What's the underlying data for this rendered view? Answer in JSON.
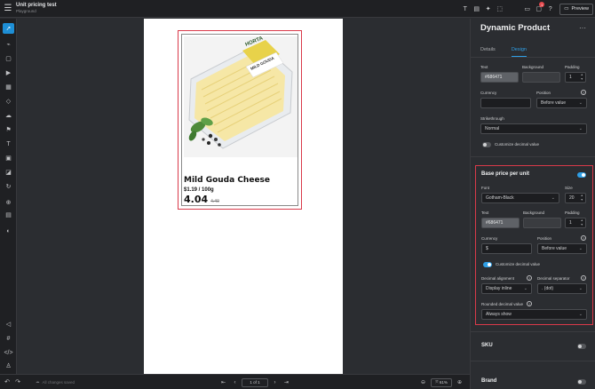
{
  "header": {
    "title": "Unit pricing test",
    "subtitle": "Playground",
    "preview_label": "Preview",
    "notification_count": "1"
  },
  "canvas": {
    "product": {
      "name": "Mild Gouda Cheese",
      "unit_price": "$1.19 / 100g",
      "price": "4.04",
      "old_price": "4.49",
      "package_brand": "HORTA",
      "package_label": "MILD GOUDA"
    }
  },
  "bottombar": {
    "saved_status": "All changes saved",
    "page_indicator": "1 of 1",
    "zoom": "61%"
  },
  "panel": {
    "title": "Dynamic Product",
    "tabs": [
      "Details",
      "Design"
    ],
    "active_tab": "Design",
    "top": {
      "text_label": "Text",
      "text_color": "#686471",
      "background_label": "Background",
      "padding_label": "Padding",
      "padding_value": "1",
      "currency_label": "Currency",
      "currency_value": "",
      "position_label": "Position",
      "position_value": "Before value",
      "strikethrough_label": "Strikethrough",
      "strikethrough_value": "Normal",
      "customize_decimal_label": "Customize decimal value"
    },
    "base_price": {
      "title": "Base price per unit",
      "font_label": "Font",
      "font_value": "Gotham-Black",
      "size_label": "Size",
      "size_value": "20",
      "text_label": "Text",
      "text_color": "#686471",
      "background_label": "Background",
      "padding_label": "Padding",
      "padding_value": "1",
      "currency_label": "Currency",
      "currency_value": "$",
      "position_label": "Position",
      "position_value": "Before value",
      "customize_decimal_label": "Customize decimal value",
      "decimal_alignment_label": "Decimal alignment",
      "decimal_alignment_value": "Display inline",
      "decimal_separator_label": "Decimal separator",
      "decimal_separator_value": ". (dot)",
      "rounded_label": "Rounded decimal value",
      "rounded_value": "Always show"
    },
    "sku_label": "SKU",
    "brand_label": "Brand"
  },
  "colors": {
    "accent": "#2f9fe6",
    "highlight": "#d93a4a",
    "badge": "#e5484d"
  }
}
